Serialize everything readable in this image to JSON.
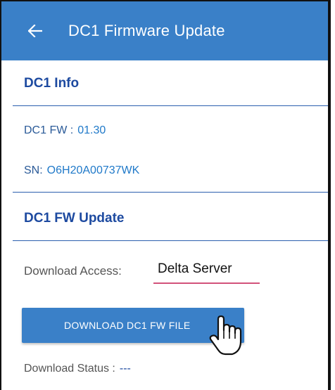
{
  "appbar": {
    "title": "DC1 Firmware Update",
    "back_icon": "arrow-left-icon"
  },
  "info_section": {
    "title": "DC1 Info",
    "fw_label": "DC1 FW :",
    "fw_value": "01.30",
    "sn_label": "SN:",
    "sn_value": "O6H20A00737WK"
  },
  "update_section": {
    "title": "DC1 FW Update",
    "access_label": "Download Access:",
    "access_value": "Delta Server",
    "download_button_label": "DOWNLOAD DC1 FW FILE",
    "status_label": "Download Status :",
    "status_value": "---"
  },
  "colors": {
    "appbar": "#3a80c8",
    "section_title": "#1d4aa0",
    "value_text": "#1f79c9",
    "underline": "#d2527a"
  },
  "cursor_icon": "hand-pointer-icon"
}
